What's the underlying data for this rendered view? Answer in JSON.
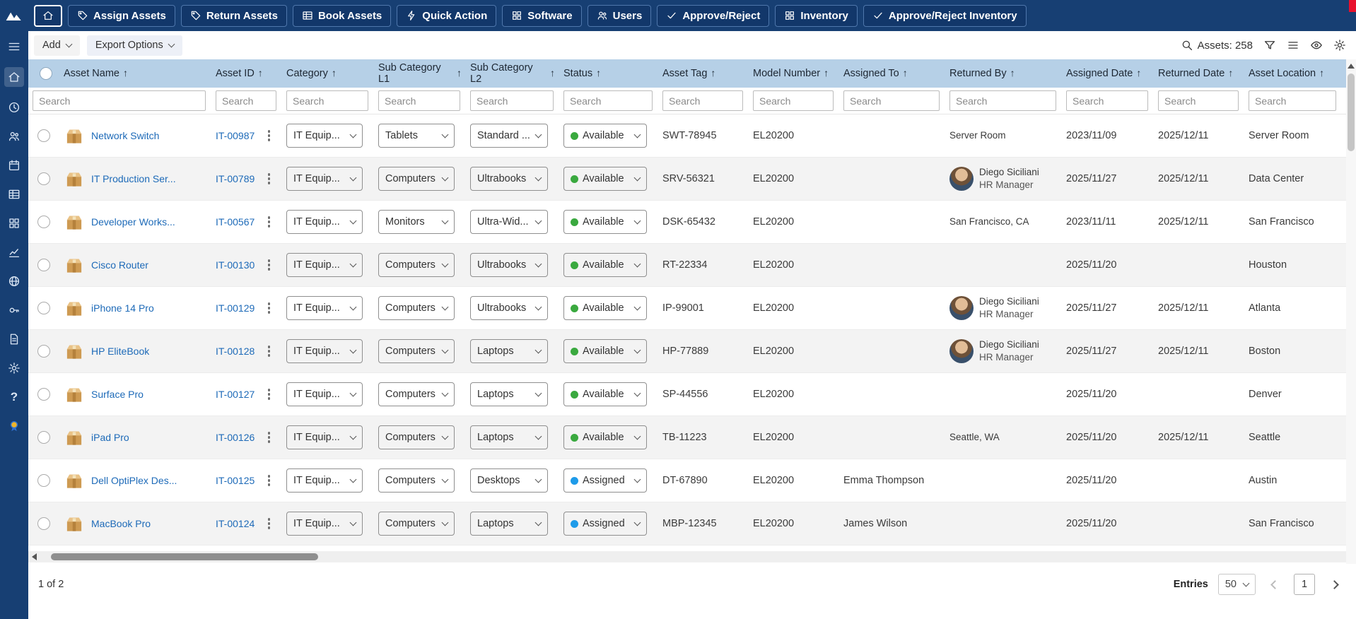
{
  "topbar": {
    "buttons": [
      {
        "label": "Assign Assets",
        "icon": "tag-icon"
      },
      {
        "label": "Return Assets",
        "icon": "tag-icon"
      },
      {
        "label": "Book Assets",
        "icon": "grid-icon"
      },
      {
        "label": "Quick Action",
        "icon": "bolt-icon"
      },
      {
        "label": "Software",
        "icon": "apps-icon"
      },
      {
        "label": "Users",
        "icon": "users-icon"
      },
      {
        "label": "Approve/Reject",
        "icon": "check-icon"
      },
      {
        "label": "Inventory",
        "icon": "apps-icon"
      },
      {
        "label": "Approve/Reject Inventory",
        "icon": "check-icon"
      }
    ]
  },
  "sidebar": {
    "icons": [
      "menu",
      "home",
      "recent",
      "users",
      "calendar",
      "asset-table",
      "apps",
      "reports",
      "web",
      "tools",
      "documents",
      "settings",
      "help",
      "rewards"
    ]
  },
  "toolbar": {
    "add_label": "Add",
    "export_label": "Export Options",
    "assets_count": "Assets: 258",
    "right_icons": [
      "search",
      "filter",
      "list",
      "eye",
      "settings"
    ]
  },
  "table": {
    "search_placeholder": "Search",
    "columns": [
      "Asset Name",
      "Asset ID",
      "Category",
      "Sub Category L1",
      "Sub Category L2",
      "Status",
      "Asset Tag",
      "Model Number",
      "Assigned To",
      "Returned By",
      "Assigned Date",
      "Returned Date",
      "Asset Location"
    ],
    "rows": [
      {
        "name": "Network Switch",
        "id": "IT-00987",
        "category": "IT Equip...",
        "sub_category_l1": "Tablets",
        "sub_category_l2": "Standard ...",
        "status": "Available",
        "status_color": "green",
        "asset_tag": "SWT-78945",
        "model_number": "EL20200",
        "assigned_to": "",
        "returned_by": "Server Room",
        "returned_by_role": "",
        "returned_by_avatar": false,
        "assigned_date": "2023/11/09",
        "returned_date": "2025/12/11",
        "asset_location": "Server Room",
        "overflow": "B"
      },
      {
        "name": "IT Production Ser...",
        "id": "IT-00789",
        "category": "IT Equip...",
        "sub_category_l1": "Computers",
        "sub_category_l2": "Ultrabooks",
        "status": "Available",
        "status_color": "green",
        "asset_tag": "SRV-56321",
        "model_number": "EL20200",
        "assigned_to": "",
        "returned_by": "Diego Siciliani",
        "returned_by_role": "HR Manager",
        "returned_by_avatar": true,
        "assigned_date": "2025/11/27",
        "returned_date": "2025/12/11",
        "asset_location": "Data Center",
        "overflow": "B"
      },
      {
        "name": "Developer Works...",
        "id": "IT-00567",
        "category": "IT Equip...",
        "sub_category_l1": "Monitors",
        "sub_category_l2": "Ultra-Wid...",
        "status": "Available",
        "status_color": "green",
        "asset_tag": "DSK-65432",
        "model_number": "EL20200",
        "assigned_to": "",
        "returned_by": "San Francisco, CA",
        "returned_by_role": "",
        "returned_by_avatar": false,
        "assigned_date": "2023/11/11",
        "returned_date": "2025/12/11",
        "asset_location": "San Francisco",
        "overflow": "B"
      },
      {
        "name": "Cisco Router",
        "id": "IT-00130",
        "category": "IT Equip...",
        "sub_category_l1": "Computers",
        "sub_category_l2": "Ultrabooks",
        "status": "Available",
        "status_color": "green",
        "asset_tag": "RT-22334",
        "model_number": "EL20200",
        "assigned_to": "",
        "returned_by": "",
        "returned_by_role": "",
        "returned_by_avatar": false,
        "assigned_date": "2025/11/20",
        "returned_date": "",
        "asset_location": "Houston",
        "overflow": "B"
      },
      {
        "name": "iPhone 14 Pro",
        "id": "IT-00129",
        "category": "IT Equip...",
        "sub_category_l1": "Computers",
        "sub_category_l2": "Ultrabooks",
        "status": "Available",
        "status_color": "green",
        "asset_tag": "IP-99001",
        "model_number": "EL20200",
        "assigned_to": "",
        "returned_by": "Diego Siciliani",
        "returned_by_role": "HR Manager",
        "returned_by_avatar": true,
        "assigned_date": "2025/11/27",
        "returned_date": "2025/12/11",
        "asset_location": "Atlanta",
        "overflow": "B"
      },
      {
        "name": "HP EliteBook",
        "id": "IT-00128",
        "category": "IT Equip...",
        "sub_category_l1": "Computers",
        "sub_category_l2": "Laptops",
        "status": "Available",
        "status_color": "green",
        "asset_tag": "HP-77889",
        "model_number": "EL20200",
        "assigned_to": "",
        "returned_by": "Diego Siciliani",
        "returned_by_role": "HR Manager",
        "returned_by_avatar": true,
        "assigned_date": "2025/11/27",
        "returned_date": "2025/12/11",
        "asset_location": "Boston",
        "overflow": "B"
      },
      {
        "name": "Surface Pro",
        "id": "IT-00127",
        "category": "IT Equip...",
        "sub_category_l1": "Computers",
        "sub_category_l2": "Laptops",
        "status": "Available",
        "status_color": "green",
        "asset_tag": "SP-44556",
        "model_number": "EL20200",
        "assigned_to": "",
        "returned_by": "",
        "returned_by_role": "",
        "returned_by_avatar": false,
        "assigned_date": "2025/11/20",
        "returned_date": "",
        "asset_location": "Denver",
        "overflow": "B"
      },
      {
        "name": "iPad Pro",
        "id": "IT-00126",
        "category": "IT Equip...",
        "sub_category_l1": "Computers",
        "sub_category_l2": "Laptops",
        "status": "Available",
        "status_color": "green",
        "asset_tag": "TB-11223",
        "model_number": "EL20200",
        "assigned_to": "",
        "returned_by": "Seattle, WA",
        "returned_by_role": "",
        "returned_by_avatar": false,
        "assigned_date": "2025/11/20",
        "returned_date": "2025/12/11",
        "asset_location": "Seattle",
        "overflow": "B"
      },
      {
        "name": "Dell OptiPlex Des...",
        "id": "IT-00125",
        "category": "IT Equip...",
        "sub_category_l1": "Computers",
        "sub_category_l2": "Desktops",
        "status": "Assigned",
        "status_color": "blue",
        "asset_tag": "DT-67890",
        "model_number": "EL20200",
        "assigned_to": "Emma Thompson",
        "returned_by": "",
        "returned_by_role": "",
        "returned_by_avatar": false,
        "assigned_date": "2025/11/20",
        "returned_date": "",
        "asset_location": "Austin",
        "overflow": "B"
      },
      {
        "name": "MacBook Pro",
        "id": "IT-00124",
        "category": "IT Equip...",
        "sub_category_l1": "Computers",
        "sub_category_l2": "Laptops",
        "status": "Assigned",
        "status_color": "blue",
        "asset_tag": "MBP-12345",
        "model_number": "EL20200",
        "assigned_to": "James Wilson",
        "returned_by": "",
        "returned_by_role": "",
        "returned_by_avatar": false,
        "assigned_date": "2025/11/20",
        "returned_date": "",
        "asset_location": "San Francisco",
        "overflow": "B"
      }
    ]
  },
  "footer": {
    "page_info": "1 of 2",
    "entries_label": "Entries",
    "entries_value": "50",
    "current_page": "1"
  },
  "colors": {
    "topbar": "#173F73",
    "header_band": "#B6D0E7",
    "link": "#1D6AB8",
    "status_available": "#3AA93F",
    "status_assigned": "#1E9BE9",
    "notification": "#E8112D"
  }
}
